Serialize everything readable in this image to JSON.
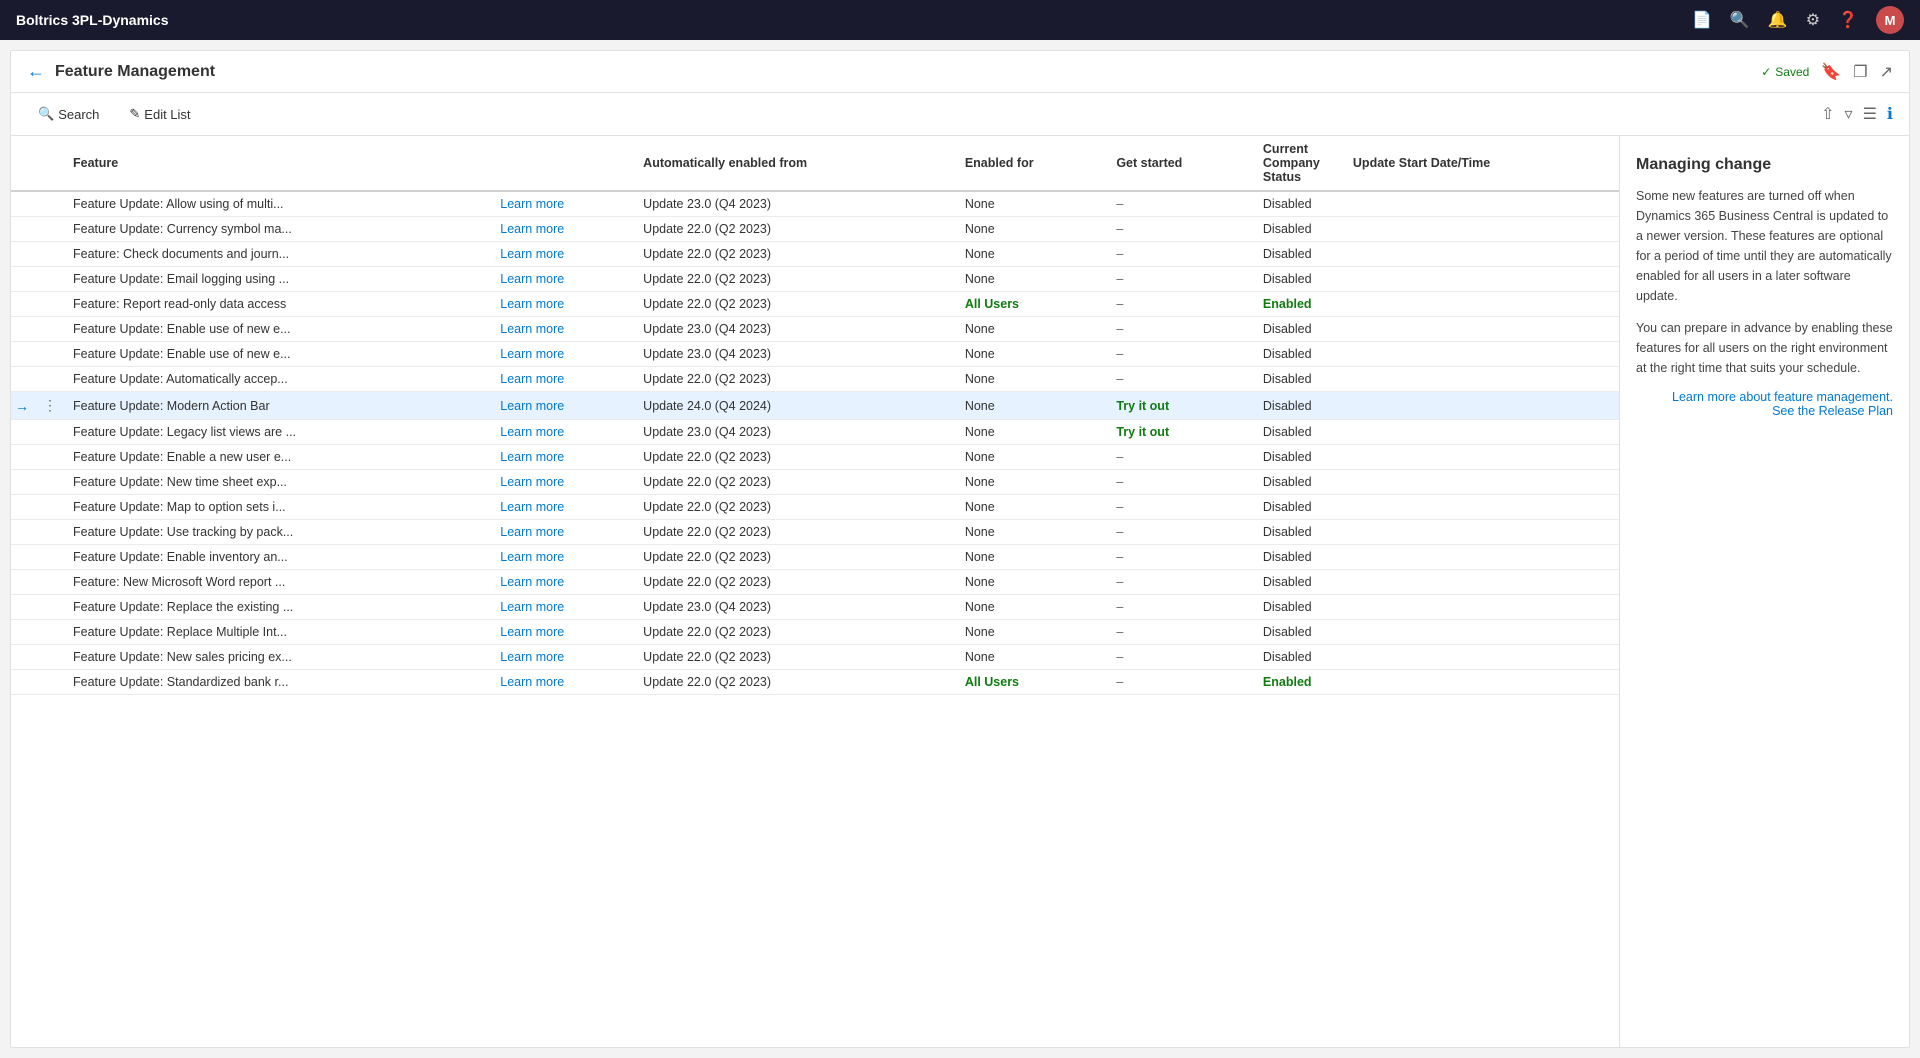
{
  "app": {
    "title": "Boltrics 3PL-Dynamics"
  },
  "topbar": {
    "icons": [
      "document-icon",
      "search-icon",
      "bell-icon",
      "settings-icon",
      "help-icon"
    ],
    "avatar_label": "M"
  },
  "page": {
    "title": "Feature Management",
    "saved_label": "Saved"
  },
  "toolbar": {
    "search_label": "Search",
    "edit_list_label": "Edit List"
  },
  "table": {
    "headers": {
      "feature": "Feature",
      "auto_enabled": "Automatically enabled from",
      "enabled_for": "Enabled for",
      "get_started": "Get started",
      "current_status_header": "Current Company Status",
      "update_start": "Update Start Date/Time"
    },
    "rows": [
      {
        "feature": "Feature Update: Allow using of multi...",
        "learn_more": "Learn more",
        "auto_enabled": "Update 23.0 (Q4 2023)",
        "enabled_for": "None",
        "get_started": "–",
        "status": "Disabled",
        "selected": false,
        "arrow": false
      },
      {
        "feature": "Feature Update: Currency symbol ma...",
        "learn_more": "Learn more",
        "auto_enabled": "Update 22.0 (Q2 2023)",
        "enabled_for": "None",
        "get_started": "–",
        "status": "Disabled",
        "selected": false,
        "arrow": false
      },
      {
        "feature": "Feature: Check documents and journ...",
        "learn_more": "Learn more",
        "auto_enabled": "Update 22.0 (Q2 2023)",
        "enabled_for": "None",
        "get_started": "–",
        "status": "Disabled",
        "selected": false,
        "arrow": false
      },
      {
        "feature": "Feature Update: Email logging using ...",
        "learn_more": "Learn more",
        "auto_enabled": "Update 22.0 (Q2 2023)",
        "enabled_for": "None",
        "get_started": "–",
        "status": "Disabled",
        "selected": false,
        "arrow": false
      },
      {
        "feature": "Feature: Report read-only data access",
        "learn_more": "Learn more",
        "auto_enabled": "Update 22.0 (Q2 2023)",
        "enabled_for": "All Users",
        "get_started": "–",
        "status": "Enabled",
        "selected": false,
        "arrow": false,
        "highlight": true
      },
      {
        "feature": "Feature Update: Enable use of new e...",
        "learn_more": "Learn more",
        "auto_enabled": "Update 23.0 (Q4 2023)",
        "enabled_for": "None",
        "get_started": "–",
        "status": "Disabled",
        "selected": false,
        "arrow": false
      },
      {
        "feature": "Feature Update: Enable use of new e...",
        "learn_more": "Learn more",
        "auto_enabled": "Update 23.0 (Q4 2023)",
        "enabled_for": "None",
        "get_started": "–",
        "status": "Disabled",
        "selected": false,
        "arrow": false
      },
      {
        "feature": "Feature Update: Automatically accep...",
        "learn_more": "Learn more",
        "auto_enabled": "Update 22.0 (Q2 2023)",
        "enabled_for": "None",
        "get_started": "–",
        "status": "Disabled",
        "selected": false,
        "arrow": false
      },
      {
        "feature": "Feature Update: Modern Action Bar",
        "learn_more": "Learn more",
        "auto_enabled": "Update 24.0 (Q4 2024)",
        "enabled_for": "None",
        "get_started": "Try it out",
        "status": "Disabled",
        "selected": true,
        "arrow": true
      },
      {
        "feature": "Feature Update: Legacy list views are ...",
        "learn_more": "Learn more",
        "auto_enabled": "Update 23.0 (Q4 2023)",
        "enabled_for": "None",
        "get_started": "Try it out",
        "status": "Disabled",
        "selected": false,
        "arrow": false
      },
      {
        "feature": "Feature Update: Enable a new user e...",
        "learn_more": "Learn more",
        "auto_enabled": "Update 22.0 (Q2 2023)",
        "enabled_for": "None",
        "get_started": "–",
        "status": "Disabled",
        "selected": false,
        "arrow": false
      },
      {
        "feature": "Feature Update: New time sheet exp...",
        "learn_more": "Learn more",
        "auto_enabled": "Update 22.0 (Q2 2023)",
        "enabled_for": "None",
        "get_started": "–",
        "status": "Disabled",
        "selected": false,
        "arrow": false
      },
      {
        "feature": "Feature Update: Map to option sets i...",
        "learn_more": "Learn more",
        "auto_enabled": "Update 22.0 (Q2 2023)",
        "enabled_for": "None",
        "get_started": "–",
        "status": "Disabled",
        "selected": false,
        "arrow": false
      },
      {
        "feature": "Feature Update: Use tracking by pack...",
        "learn_more": "Learn more",
        "auto_enabled": "Update 22.0 (Q2 2023)",
        "enabled_for": "None",
        "get_started": "–",
        "status": "Disabled",
        "selected": false,
        "arrow": false
      },
      {
        "feature": "Feature Update: Enable inventory an...",
        "learn_more": "Learn more",
        "auto_enabled": "Update 22.0 (Q2 2023)",
        "enabled_for": "None",
        "get_started": "–",
        "status": "Disabled",
        "selected": false,
        "arrow": false
      },
      {
        "feature": "Feature: New Microsoft Word report ...",
        "learn_more": "Learn more",
        "auto_enabled": "Update 22.0 (Q2 2023)",
        "enabled_for": "None",
        "get_started": "–",
        "status": "Disabled",
        "selected": false,
        "arrow": false
      },
      {
        "feature": "Feature Update: Replace the existing ...",
        "learn_more": "Learn more",
        "auto_enabled": "Update 23.0 (Q4 2023)",
        "enabled_for": "None",
        "get_started": "–",
        "status": "Disabled",
        "selected": false,
        "arrow": false
      },
      {
        "feature": "Feature Update: Replace Multiple Int...",
        "learn_more": "Learn more",
        "auto_enabled": "Update 22.0 (Q2 2023)",
        "enabled_for": "None",
        "get_started": "–",
        "status": "Disabled",
        "selected": false,
        "arrow": false
      },
      {
        "feature": "Feature Update: New sales pricing ex...",
        "learn_more": "Learn more",
        "auto_enabled": "Update 22.0 (Q2 2023)",
        "enabled_for": "None",
        "get_started": "–",
        "status": "Disabled",
        "selected": false,
        "arrow": false
      },
      {
        "feature": "Feature Update: Standardized bank r...",
        "learn_more": "Learn more",
        "auto_enabled": "Update 22.0 (Q2 2023)",
        "enabled_for": "All Users",
        "get_started": "–",
        "status": "Enabled",
        "selected": false,
        "arrow": false,
        "highlight": true
      }
    ]
  },
  "side_panel": {
    "title": "Managing change",
    "text1": "Some new features are turned off when Dynamics 365 Business Central is updated to a newer version. These features are optional for a period of time until they are automatically enabled for all users in a later software update.",
    "text2": "You can prepare in advance by enabling these features for all users on the right environment at the right time that suits your schedule.",
    "link1": "Learn more about feature management.",
    "link2": "See the Release Plan"
  }
}
